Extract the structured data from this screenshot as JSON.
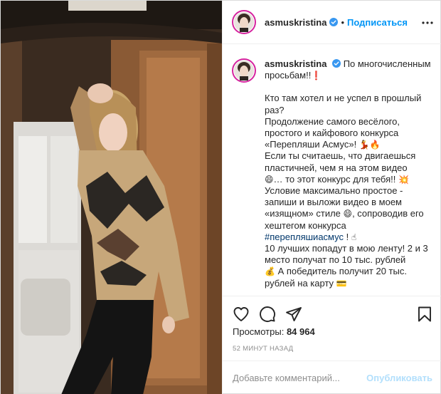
{
  "header": {
    "username": "asmuskristina",
    "separator": "•",
    "follow_label": "Подписаться"
  },
  "caption": {
    "username": "asmuskristina",
    "lines": [
      "По многочисленным просьбам!!",
      "Кто там хотел и не успел в прошлый раз?",
      "Продолжение самого весёлого, простого и кайфового конкурса «Перепляши Асмус»!",
      "Если ты считаешь, что двигаешься пластичней, чем я на этом видео",
      "… то этот конкурс для тебя!!",
      "Условие максимально простое - запиши и выложи видео в моем «изящном» стиле",
      ", сопроводив его хештегом конкурса",
      "#перепляшиасмус",
      "!",
      "10 лучших попадут в мою ленту! 2 и 3 место получат по 10 тыс. рублей",
      "А победитель получит 20 тыс. рублей на карту"
    ],
    "emojis": {
      "exclamation": "❗",
      "dancer_fire": "💃🔥",
      "grin": "😄",
      "boom": "💥",
      "point_up": "☝",
      "money_bag": "💰",
      "card": "💳"
    }
  },
  "actions": {
    "like": "heart-icon",
    "comment": "comment-icon",
    "share": "share-icon",
    "save": "bookmark-icon"
  },
  "stats": {
    "views_label": "Просмотры: ",
    "views_count": "84 964",
    "timestamp": "52 минут назад"
  },
  "comment": {
    "placeholder": "Добавьте комментарий...",
    "post_label": "Опубликовать"
  },
  "colors": {
    "accent": "#0095f6",
    "hashtag": "#00376b",
    "muted": "#8e8e8e",
    "post_disabled": "#b2dffc"
  }
}
